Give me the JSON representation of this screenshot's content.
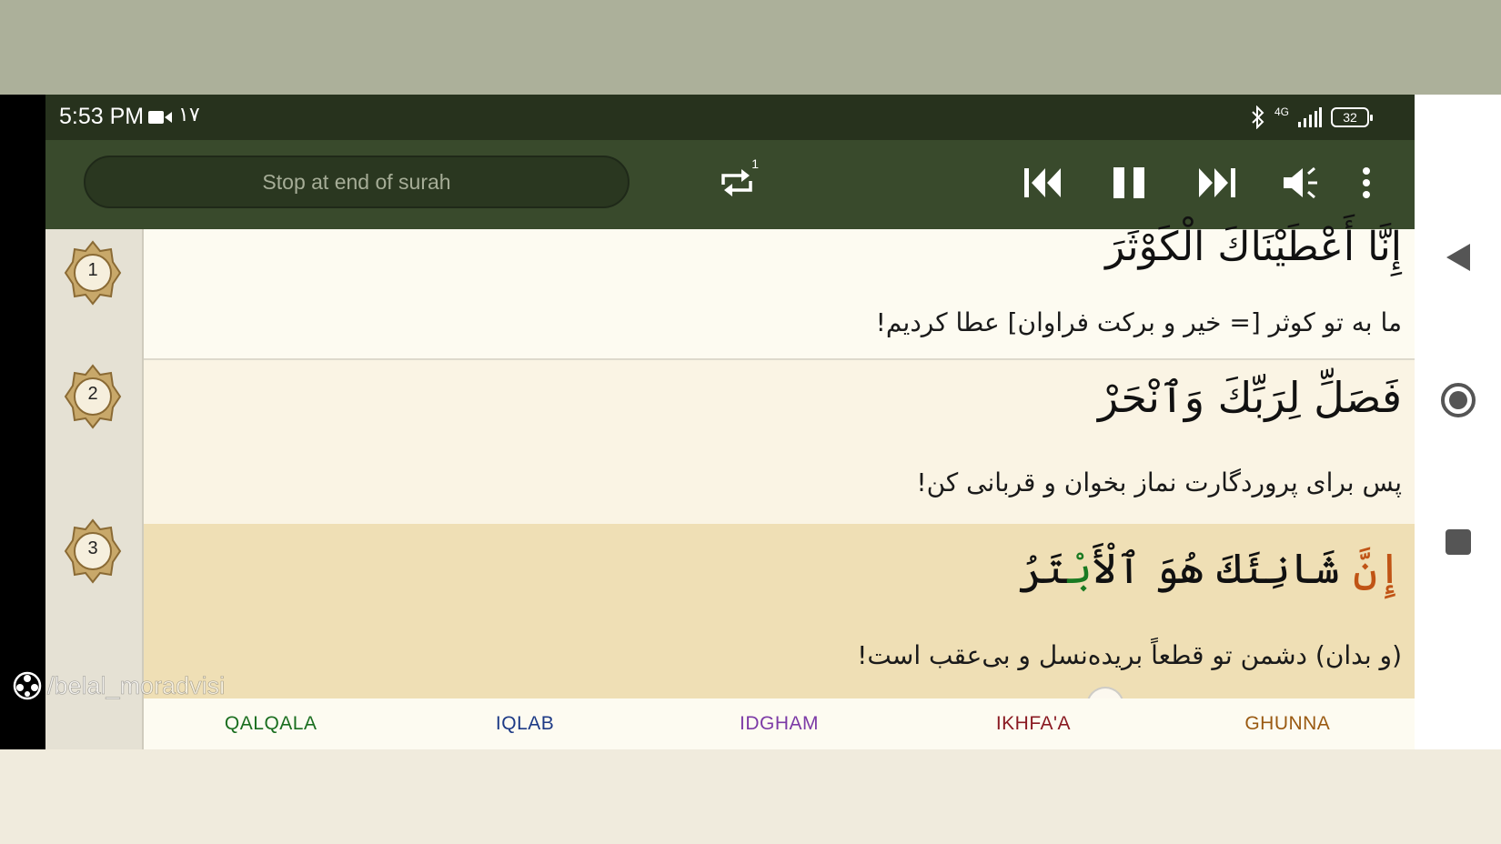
{
  "status_bar": {
    "time": "5:53 PM",
    "extra": "۱۷",
    "network": "4G",
    "battery": "32",
    "icons": [
      "video-camera-icon",
      "bluetooth-icon",
      "signal-icon",
      "battery-icon"
    ]
  },
  "toolbar": {
    "stop_label": "Stop at end of surah",
    "repeat_count": "1",
    "icons": [
      "repeat-icon",
      "previous-icon",
      "pause-icon",
      "next-icon",
      "mute-icon",
      "more-icon"
    ]
  },
  "verses": [
    {
      "number": "1",
      "arabic": "إِنَّا أَعْطَيْنَاكَ الْكَوْثَرَ",
      "translation": "ما به تو کوثر [= خیر و برکت فراوان] عطا کردیم!"
    },
    {
      "number": "2",
      "arabic": "فَصَلِّ لِرَبِّكَ وَٱنْحَرْ",
      "translation": "پس برای پروردگارت نماز بخوان و قربانی کن!"
    },
    {
      "number": "3",
      "arabic_parts": [
        {
          "text": "إِنَّ",
          "rule": "ghunna"
        },
        {
          "text": " شَانِئَكَ هُوَ ٱلْأَ",
          "rule": ""
        },
        {
          "text": "بْ",
          "rule": "qalqala"
        },
        {
          "text": "تَرُ",
          "rule": ""
        }
      ],
      "translation": "(و بدان) دشمن تو قطعاً بریده‌نسل و بی‌عقب است!"
    }
  ],
  "legend": [
    {
      "label": "QALQALA",
      "color": "#1a6e1f"
    },
    {
      "label": "IQLAB",
      "color": "#1d3a86"
    },
    {
      "label": "IDGHAM",
      "color": "#7c3aa6"
    },
    {
      "label": "IKHFA'A",
      "color": "#8a1a22"
    },
    {
      "label": "GHUNNA",
      "color": "#9a5a12"
    }
  ],
  "watermark": "/belal_moradvisi",
  "colors": {
    "status_bar": "#27321d",
    "toolbar": "#394a2c",
    "highlight_verse": "#efdfb5",
    "ghunna": "#c05415",
    "qalqala": "#1a7a22"
  }
}
